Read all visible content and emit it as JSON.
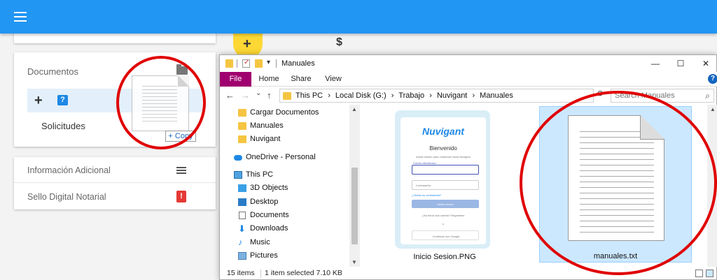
{
  "web": {
    "docs_title": "Documentos",
    "docs_add": "+",
    "docs_help": "?",
    "docs_item": "Solicitudes",
    "info_title": "Información Adicional",
    "sello_title": "Sello Digital Notarial",
    "fab_label": "+",
    "currency": "$",
    "copy_tooltip": "+ Copy"
  },
  "explorer": {
    "title": "Manuales",
    "tabs": [
      "File",
      "Home",
      "Share",
      "View"
    ],
    "help": "?",
    "controls": {
      "minimize": "—",
      "maximize": "☐",
      "close": "✕"
    },
    "nav_buttons": {
      "back": "←",
      "forward": "→",
      "recent": "⌄",
      "up": "↑"
    },
    "breadcrumbs": [
      "This PC",
      "›",
      "Local Disk (G:)",
      "›",
      "Trabajo",
      "›",
      "Nuvigant",
      "›",
      "Manuales"
    ],
    "search_placeholder": "Search Manuales",
    "nav_items": [
      {
        "label": "Cargar Documentos",
        "icon": "folder-icon"
      },
      {
        "label": "Manuales",
        "icon": "folder-icon"
      },
      {
        "label": "Nuvigant",
        "icon": "folder-icon"
      },
      {
        "label": "OneDrive - Personal",
        "icon": "cloud-icon"
      },
      {
        "label": "This PC",
        "icon": "computer-icon"
      },
      {
        "label": "3D Objects",
        "icon": "cube-icon"
      },
      {
        "label": "Desktop",
        "icon": "desktop-icon"
      },
      {
        "label": "Documents",
        "icon": "document-icon"
      },
      {
        "label": "Downloads",
        "icon": "download-icon"
      },
      {
        "label": "Music",
        "icon": "music-icon"
      },
      {
        "label": "Pictures",
        "icon": "picture-icon"
      }
    ],
    "files": [
      {
        "name": "Inicio Sesion.PNG",
        "selected": false
      },
      {
        "name": "manuales.txt",
        "selected": true
      }
    ],
    "preview": {
      "brand": "Nuvigant",
      "welcome": "Bienvenido",
      "subtitle": "Iniciar sesión para continuar hacia Nuvigant",
      "email_label": "Correo electrónico",
      "password_placeholder": "Contraseña",
      "forgot": "¿Olvidó su contraseña?",
      "login_button": "Iniciar sesión",
      "register": "¿No tiene una cuenta? Regístrese",
      "divider": "o",
      "google": "Continuar con Google"
    },
    "status": {
      "items": "15 items",
      "selection": "1 item selected  7.10 KB"
    }
  }
}
